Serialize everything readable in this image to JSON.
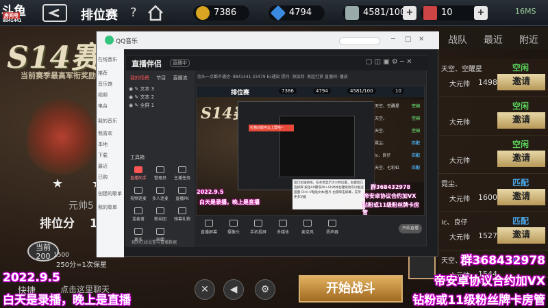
{
  "top_bar": {
    "logo_text": "斗鱼",
    "logo_sub": "房间号",
    "room_id": "8841441",
    "page_title": "排位赛",
    "help": "?",
    "resources": [
      {
        "name": "gold",
        "value": "7386",
        "color": "#d9a520"
      },
      {
        "name": "diamond",
        "value": "4794",
        "color": "#3a8be0"
      },
      {
        "name": "crystal",
        "value": "4581/100",
        "color": "#9aa"
      },
      {
        "name": "card",
        "value": "10",
        "color": "#c44"
      }
    ],
    "ping": "16MS"
  },
  "season": {
    "title": "S14赛",
    "subtitle": "当前赛季最高军衔奖励",
    "rank_name": "元帅5",
    "score_label": "排位分",
    "score_value": "1",
    "stars": "★ ★",
    "pts_badge_top": "当前",
    "pts_badge_value": "200",
    "pts_line": "250分=1次保星",
    "pts_small": "1500"
  },
  "bottom": {
    "shortcut": "快捷",
    "search_hint": "点击这里聊天",
    "start_battle": "开始战斗"
  },
  "right_tabs": [
    "战队",
    "最近",
    "附近"
  ],
  "friends": [
    {
      "name": "天空、空醒星",
      "rank": "大元帅",
      "score": "1498",
      "status": "空闲",
      "status_color": "#5bd35b",
      "button": "邀请"
    },
    {
      "name": "",
      "rank": "大元帅",
      "score": "",
      "status": "空闲",
      "status_color": "#5bd35b",
      "button": "邀请"
    },
    {
      "name": "",
      "rank": "大元帅",
      "score": "",
      "status": "空闲",
      "status_color": "#5bd35b",
      "button": "邀请"
    },
    {
      "name": "霓尘、",
      "rank": "大元帅",
      "score": "1600",
      "status": "匹配",
      "status_color": "#4aa8e8",
      "button": "邀请"
    },
    {
      "name": "Ic、良仔",
      "rank": "大元帅",
      "score": "1527",
      "status": "匹配",
      "status_color": "#4aa8e8",
      "button": "邀请"
    },
    {
      "name": "天空、七彩虹",
      "rank": "大元帅",
      "score": "1544",
      "status": "匹配",
      "status_color": "#4aa8e8",
      "button": "邀请"
    }
  ],
  "qq_music": {
    "title": "QQ音乐",
    "side_items": [
      "在线音乐",
      "推荐",
      "音乐馆",
      "视频",
      "电台",
      "我的音乐",
      "我喜欢",
      "本地",
      "下载",
      "最近",
      "已购",
      "创建的歌单",
      "我的歌单"
    ]
  },
  "live_app": {
    "title": "直播伴侣",
    "tag": "直播中",
    "scene_tabs": [
      "我的场景",
      "节目",
      "直播流"
    ],
    "scenes": [
      "文本 3",
      "文本 2",
      "全屏 1"
    ],
    "tool_title": "工具箱",
    "tools": [
      "直播助手",
      "管理员",
      "主播任务",
      "视频连麦",
      "多人连麦",
      "直播PK",
      "连麦者",
      "粉丝团",
      "弹幕礼物",
      "更多",
      "画面"
    ],
    "bottom_link": "我的在线设置与直播数据",
    "meta": "念头一点都不通达·   8841441   23479   Ec通知   提问·   添加到·   发起打赏   直播间·   播放",
    "controls": [
      "直播屏幕",
      "摄像头",
      "手机投屏",
      "多媒体",
      "麦克风",
      "扬声器"
    ],
    "start_live": "开始直播",
    "preview": {
      "mini_title": "排位赛",
      "mini_res": [
        "7386",
        "4794",
        "4581/100",
        "10"
      ],
      "mini_s14": "S14赛",
      "red_popup": "礼物功能可以上屏啦~",
      "tooltip": "窗口化辅助线，在本地显示大小和位置，右键窗口选择库 按住Alt键或Alt+Shift并左键拖动可以框选画面 Ctrl+V粘贴文本/图片 右键单击屏幕，支持更多功能",
      "overlay_left_1": "2022.9.5",
      "overlay_left_2": "白天是录播，晚上是直播",
      "overlay_right_1": "群368432978",
      "overlay_right_2": "帝安卓协议合约加VX",
      "overlay_right_3": "钻粉或11级粉丝牌卡房管",
      "mini_rows": [
        {
          "name": "天空、空醒星",
          "status": "空闲"
        },
        {
          "name": "天空、",
          "status": "空闲"
        },
        {
          "name": "天空、",
          "status": "空闲"
        },
        {
          "name": "霓尘、",
          "status": "匹配"
        },
        {
          "name": "Ic、良仔",
          "status": "匹配"
        },
        {
          "name": "天空、七彩虹",
          "status": "匹配"
        }
      ]
    }
  },
  "overlays": {
    "left_date": "2022.9.5",
    "left_text": "白天是录播，晚上是直播",
    "right_group": "群368432978",
    "right_text_1": "帝安卓协议合约加VX",
    "right_text_2": "钻粉或11级粉丝牌卡房管"
  }
}
